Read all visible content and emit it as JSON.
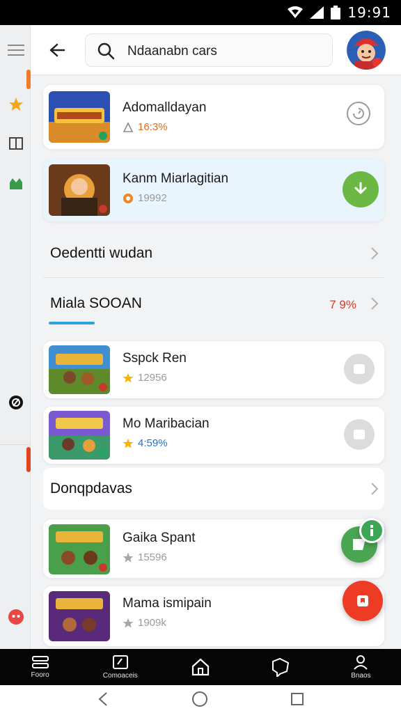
{
  "status_bar": {
    "time": "19:91",
    "icons": [
      "wifi-icon",
      "signal-icon",
      "battery-icon"
    ]
  },
  "search": {
    "value": "Ndaanabn cars"
  },
  "left_rail": {
    "icons": [
      "menu-icon",
      "star-icon",
      "book-icon",
      "store-icon",
      "ring-icon",
      "alert-icon"
    ]
  },
  "top_results": [
    {
      "title": "Adomalldayan",
      "meta": "16:3%",
      "meta_color": "#e06a1b",
      "action": "refresh-icon"
    },
    {
      "title": "Kanm Miarlagitian",
      "meta": "19992",
      "meta_color": "#9a9a9a",
      "action": "download-icon"
    }
  ],
  "sections": {
    "first": {
      "title": "Oedentti wudan"
    },
    "second": {
      "title": "Miala SOOAN",
      "value": "7 9%"
    },
    "third": {
      "title": "Donqpdavas"
    }
  },
  "section_list": [
    {
      "title": "Sspck Ren",
      "meta": "12956",
      "meta_color": "#9a9a9a"
    },
    {
      "title": "Mo Maribacian",
      "meta": "4:59%",
      "meta_color": "#1e72c8"
    }
  ],
  "bottom_list": [
    {
      "title": "Gaika Spant",
      "meta": "15596"
    },
    {
      "title": "Mama ismipain",
      "meta": "1909k"
    }
  ],
  "bottom_nav": [
    {
      "label": "Fooro",
      "icon": "home-grid-icon"
    },
    {
      "label": "Comoaceis",
      "icon": "map-icon"
    },
    {
      "label": "",
      "icon": "house-icon"
    },
    {
      "label": "",
      "icon": "chat-bubble-icon"
    },
    {
      "label": "Bnaos",
      "icon": "profile-icon"
    }
  ],
  "colors": {
    "accent_green": "#6cb844",
    "accent_red": "#ee3b24",
    "accent_blue": "#2ea1de",
    "star": "#f5b400"
  }
}
